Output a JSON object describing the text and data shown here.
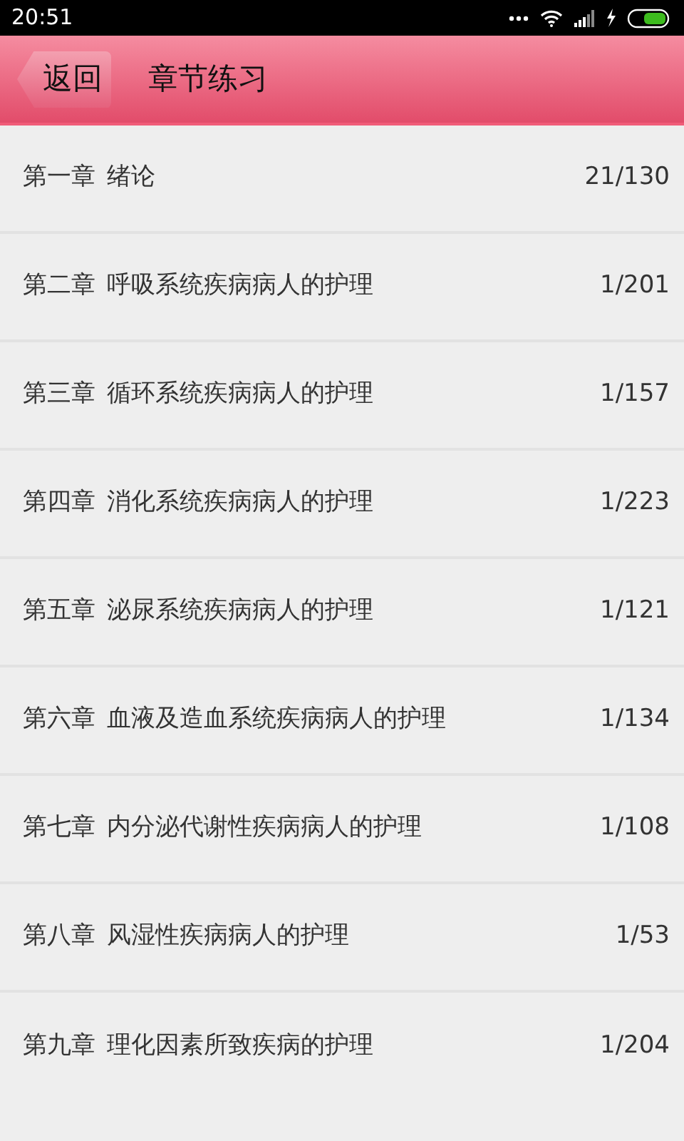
{
  "status_bar": {
    "time": "20:51"
  },
  "header": {
    "back": "返回",
    "title": "章节练习"
  },
  "chapters": [
    {
      "chapter": "第一章",
      "title": "绪论",
      "progress": "21/130"
    },
    {
      "chapter": "第二章",
      "title": "呼吸系统疾病病人的护理",
      "progress": "1/201"
    },
    {
      "chapter": "第三章",
      "title": "循环系统疾病病人的护理",
      "progress": "1/157"
    },
    {
      "chapter": "第四章",
      "title": "消化系统疾病病人的护理",
      "progress": "1/223"
    },
    {
      "chapter": "第五章",
      "title": "泌尿系统疾病病人的护理",
      "progress": "1/121"
    },
    {
      "chapter": "第六章",
      "title": "血液及造血系统疾病病人的护理",
      "progress": "1/134"
    },
    {
      "chapter": "第七章",
      "title": "内分泌代谢性疾病病人的护理",
      "progress": "1/108"
    },
    {
      "chapter": "第八章",
      "title": "风湿性疾病病人的护理",
      "progress": "1/53"
    },
    {
      "chapter": "第九章",
      "title": "理化因素所致疾病的护理",
      "progress": "1/204"
    }
  ]
}
